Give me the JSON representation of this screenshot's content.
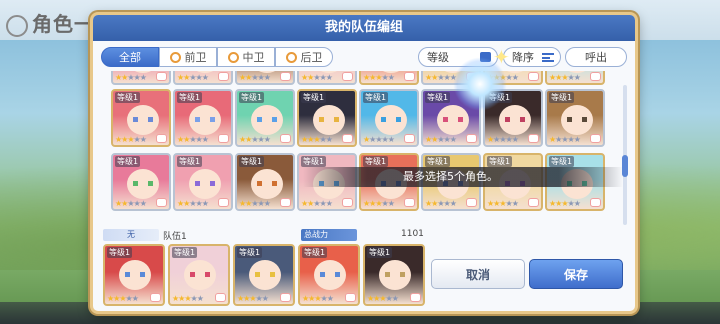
{
  "background": {
    "title": "角色一览"
  },
  "dialog": {
    "title": "我的队伍编组"
  },
  "filters": {
    "tabs": [
      {
        "label": "全部",
        "active": true
      },
      {
        "label": "前卫",
        "active": false
      },
      {
        "label": "中卫",
        "active": false
      },
      {
        "label": "后卫",
        "active": false
      }
    ],
    "sort_field": "等级",
    "order_label": "降序",
    "call_label": "呼出"
  },
  "toast": "最多选择5个角色。",
  "grid": {
    "level_label": "等级1",
    "rows": [
      [
        {
          "hair": "#e8707a",
          "eyes": "#6a8ad8",
          "stars": 3,
          "border": "gold"
        },
        {
          "hair": "#e86a78",
          "eyes": "#7aa0e8",
          "stars": 2,
          "border": "silver"
        },
        {
          "hair": "#6fd3b0",
          "eyes": "#5aa0e8",
          "stars": 2,
          "border": "silver"
        },
        {
          "hair": "#2e2e3e",
          "eyes": "#e8b440",
          "stars": 3,
          "border": "gold"
        },
        {
          "hair": "#52b8e8",
          "eyes": "#3aa0e0",
          "stars": 1,
          "border": "silver"
        },
        {
          "hair": "#6a4aa8",
          "eyes": "#d8507a",
          "stars": 2,
          "border": "silver"
        },
        {
          "hair": "#3a2a2a",
          "eyes": "#c04060",
          "stars": 1,
          "border": "silver"
        },
        {
          "hair": "#a87a4a",
          "eyes": "#5a4a3a",
          "stars": 1,
          "border": "silver"
        }
      ],
      [
        {
          "hair": "#e87a9a",
          "eyes": "#5ab86a",
          "stars": 2,
          "border": "silver"
        },
        {
          "hair": "#f0a0b0",
          "eyes": "#8a6ad8",
          "stars": 2,
          "border": "silver"
        },
        {
          "hair": "#8a5a3a",
          "eyes": "#d07030",
          "stars": 2,
          "border": "silver"
        },
        {
          "hair": "#f0b8c0",
          "eyes": "#5aa0d8",
          "stars": 2,
          "border": "silver"
        },
        {
          "hair": "#e8705a",
          "eyes": "#5a8ad8",
          "stars": 3,
          "border": "gold"
        },
        {
          "hair": "#e8c870",
          "eyes": "#6a8ad8",
          "stars": 2,
          "border": "silver"
        },
        {
          "hair": "#f0d8a0",
          "eyes": "#b06ad8",
          "stars": 3,
          "border": "gold"
        },
        {
          "hair": "#a8e0e8",
          "eyes": "#5ac8a0",
          "stars": 3,
          "border": "gold"
        }
      ]
    ]
  },
  "team": {
    "slot_label": "无",
    "name": "队伍1",
    "power_label": "总战力",
    "power_value": "1101",
    "members": [
      {
        "hair": "#d84a4a",
        "eyes": "#5a8ad8",
        "stars": 3,
        "border": "gold"
      },
      {
        "hair": "#f0d0d8",
        "eyes": "#d84a6a",
        "stars": 3,
        "border": "gold"
      },
      {
        "hair": "#4a5a7a",
        "eyes": "#e8c040",
        "stars": 3,
        "border": "gold"
      },
      {
        "hair": "#e8604a",
        "eyes": "#5a8ad8",
        "stars": 3,
        "border": "gold"
      },
      {
        "hair": "#3a2a2a",
        "eyes": "#c0a060",
        "stars": 3,
        "border": "gold"
      }
    ]
  },
  "actions": {
    "cancel": "取消",
    "save": "保存"
  }
}
